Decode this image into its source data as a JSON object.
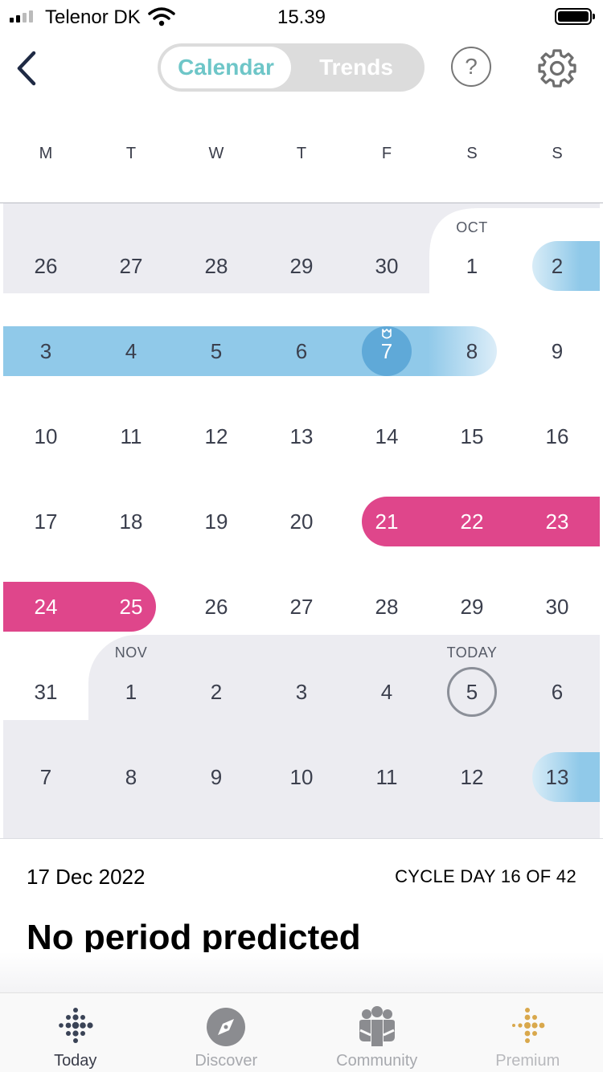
{
  "status_bar": {
    "carrier": "Telenor DK",
    "time": "15.39"
  },
  "header": {
    "tabs": [
      {
        "label": "Calendar",
        "active": true
      },
      {
        "label": "Trends",
        "active": false
      }
    ],
    "help_glyph": "?",
    "icons": [
      "back-arrow-icon",
      "help-icon",
      "gear-icon"
    ]
  },
  "weekdays": [
    "M",
    "T",
    "W",
    "T",
    "F",
    "S",
    "S"
  ],
  "month_labels": {
    "oct": "OCT",
    "nov": "NOV",
    "today": "TODAY"
  },
  "calendar": {
    "weeks": [
      [
        "26",
        "27",
        "28",
        "29",
        "30",
        "1",
        "2"
      ],
      [
        "3",
        "4",
        "5",
        "6",
        "7",
        "8",
        "9"
      ],
      [
        "10",
        "11",
        "12",
        "13",
        "14",
        "15",
        "16"
      ],
      [
        "17",
        "18",
        "19",
        "20",
        "21",
        "22",
        "23"
      ],
      [
        "24",
        "25",
        "26",
        "27",
        "28",
        "29",
        "30"
      ],
      [
        "31",
        "1",
        "2",
        "3",
        "4",
        "5",
        "6"
      ],
      [
        "7",
        "8",
        "9",
        "10",
        "11",
        "12",
        "13"
      ]
    ],
    "colors": {
      "fertile": "#90c9e9",
      "ovulation": "#5fa9d8",
      "period": "#df468b",
      "other_month": "#ececf1"
    }
  },
  "info": {
    "date": "17 Dec 2022",
    "cycle_day": "CYCLE DAY 16 OF 42",
    "title": "No period predicted"
  },
  "tabbar": {
    "items": [
      {
        "label": "Today",
        "icon": "today-dots-icon",
        "active": true
      },
      {
        "label": "Discover",
        "icon": "compass-icon",
        "active": false
      },
      {
        "label": "Community",
        "icon": "community-icon",
        "active": false
      },
      {
        "label": "Premium",
        "icon": "premium-dots-icon",
        "active": false
      }
    ]
  }
}
